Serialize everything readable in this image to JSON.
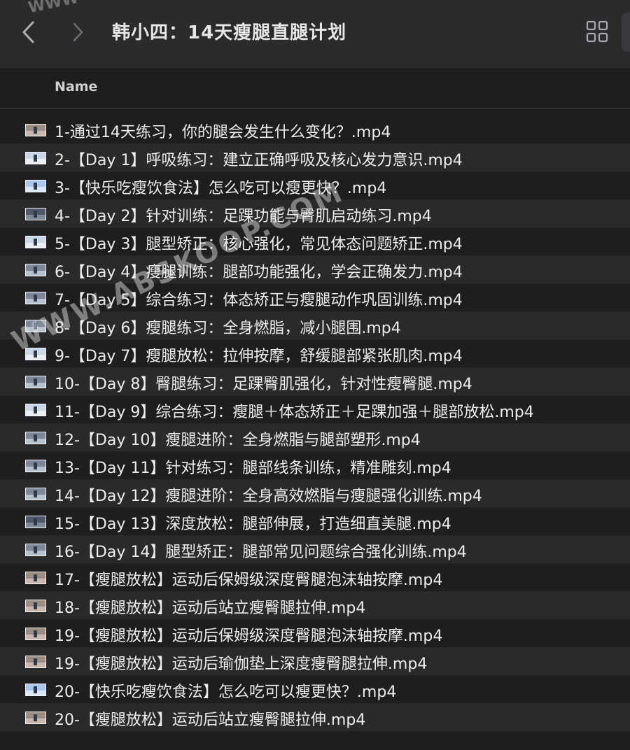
{
  "toolbar": {
    "title": "韩小四：14天瘦腿直腿计划",
    "back_icon": "chevron-left-icon",
    "forward_icon": "chevron-right-icon",
    "view_icon": "grid-view-icon"
  },
  "table": {
    "column_name": "Name"
  },
  "files": [
    {
      "name": "1-通过14天练习，你的腿会发生什么变化？.mp4",
      "thumb": "warm"
    },
    {
      "name": "2-【Day 1】呼吸练习：建立正确呼吸及核心发力意识.mp4",
      "thumb": "light"
    },
    {
      "name": "3-【快乐吃瘦饮食法】怎么吃可以瘦更快？.mp4",
      "thumb": "sky"
    },
    {
      "name": "4-【Day 2】针对训练：足踝功能与臀肌启动练习.mp4",
      "thumb": "dark"
    },
    {
      "name": "5-【Day 3】腿型矫正：核心强化，常见体态问题矫正.mp4",
      "thumb": "light"
    },
    {
      "name": "6-【Day 4】瘦腿训练：腿部功能强化，学会正确发力.mp4",
      "thumb": "normal"
    },
    {
      "name": "7-【Day 5】综合练习：体态矫正与瘦腿动作巩固训练.mp4",
      "thumb": "normal"
    },
    {
      "name": "8-【Day 6】瘦腿练习：全身燃脂，减小腿围.mp4",
      "thumb": "normal"
    },
    {
      "name": "9-【Day 7】瘦腿放松：拉伸按摩，舒缓腿部紧张肌肉.mp4",
      "thumb": "light"
    },
    {
      "name": "10-【Day 8】臀腿练习：足踝臀肌强化，针对性瘦臀腿.mp4",
      "thumb": "normal"
    },
    {
      "name": "11-【Day 9】综合练习：瘦腿＋体态矫正＋足踝加强＋腿部放松.mp4",
      "thumb": "light"
    },
    {
      "name": "12-【Day 10】瘦腿进阶：全身燃脂与腿部塑形.mp4",
      "thumb": "normal"
    },
    {
      "name": "13-【Day 11】针对练习：腿部线条训练，精准雕刻.mp4",
      "thumb": "normal"
    },
    {
      "name": "14-【Day 12】瘦腿进阶：全身高效燃脂与瘦腿强化训练.mp4",
      "thumb": "normal"
    },
    {
      "name": "15-【Day 13】深度放松：腿部伸展，打造细直美腿.mp4",
      "thumb": "dark"
    },
    {
      "name": "16-【Day 14】腿型矫正：腿部常见问题综合强化训练.mp4",
      "thumb": "normal"
    },
    {
      "name": "17-【瘦腿放松】运动后保姆级深度臀腿泡沫轴按摩.mp4",
      "thumb": "warm"
    },
    {
      "name": "18-【瘦腿放松】运动后站立瘦臀腿拉伸.mp4",
      "thumb": "warm"
    },
    {
      "name": "19-【瘦腿放松】运动后保姆级深度臀腿泡沫轴按摩.mp4",
      "thumb": "warm"
    },
    {
      "name": "19-【瘦腿放松】运动后瑜伽垫上深度瘦臀腿拉伸.mp4",
      "thumb": "warm"
    },
    {
      "name": "20-【快乐吃瘦饮食法】怎么吃可以瘦更快？.mp4",
      "thumb": "sky"
    },
    {
      "name": "20-【瘦腿放松】运动后站立瘦臀腿拉伸.mp4",
      "thumb": "warm"
    }
  ],
  "watermark": {
    "text": "WWW.ABSKOOP.COM",
    "corner": "WWW"
  },
  "colors": {
    "background": "#1e1e21",
    "toolbar": "#2b2b2e",
    "row_alt": "#2a2a2d",
    "text": "#ececec"
  }
}
